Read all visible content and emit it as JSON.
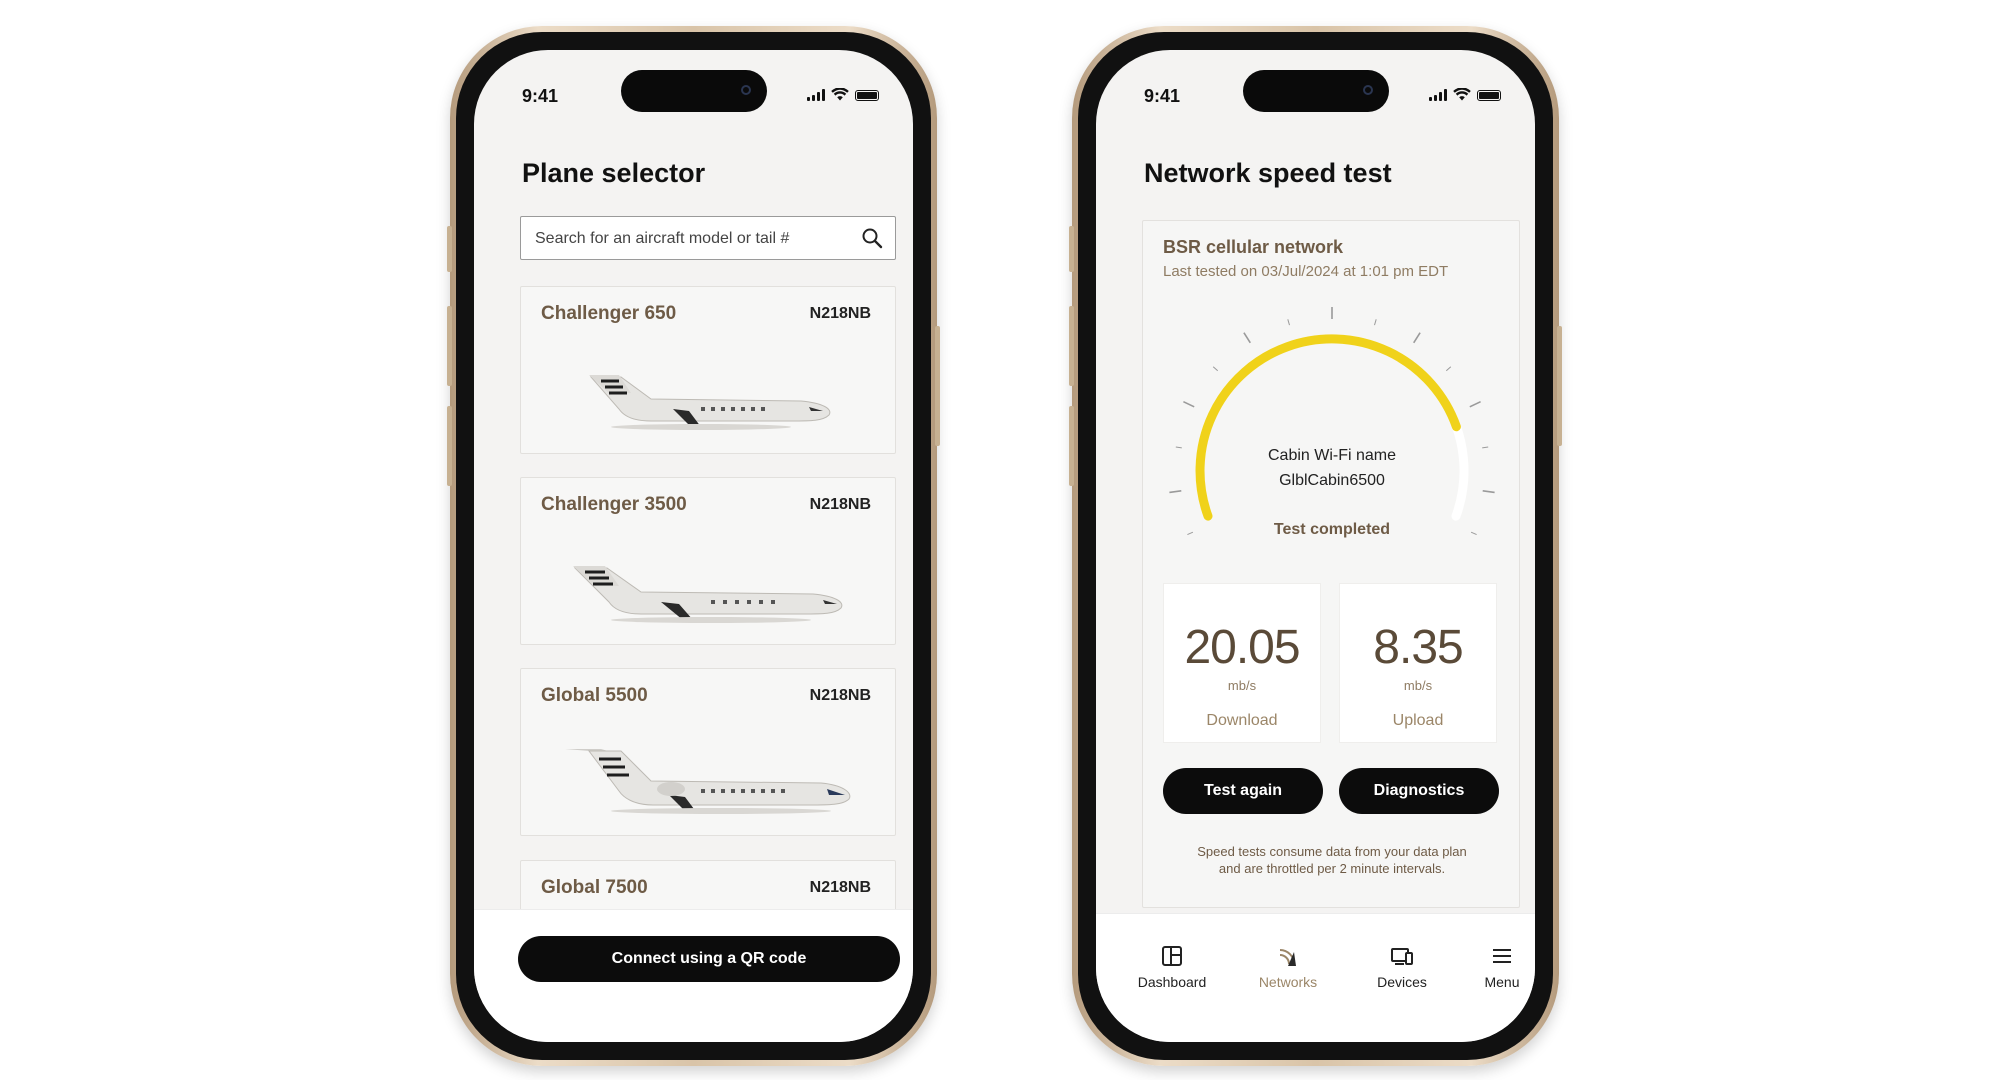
{
  "status": {
    "time": "9:41"
  },
  "plane_selector": {
    "title": "Plane selector",
    "search": {
      "placeholder": "Search for an aircraft model or tail #",
      "value": "",
      "icon": "search-icon"
    },
    "aircraft": [
      {
        "model": "Challenger 650",
        "tail": "N218NB"
      },
      {
        "model": "Challenger 3500",
        "tail": "N218NB"
      },
      {
        "model": "Global 5500",
        "tail": "N218NB"
      },
      {
        "model": "Global 7500",
        "tail": "N218NB"
      }
    ],
    "qr_button": "Connect using a QR code"
  },
  "speed_test": {
    "title": "Network speed test",
    "network_name": "BSR cellular network",
    "last_tested": "Last tested on 03/Jul/2024 at 1:01 pm EDT",
    "gauge": {
      "wifi_label": "Cabin Wi-Fi name",
      "wifi_name": "GlblCabin6500",
      "status": "Test completed",
      "progress": 0.82,
      "color": "#f0d21a"
    },
    "download": {
      "value": "20.05",
      "unit": "mb/s",
      "label": "Download"
    },
    "upload": {
      "value": "8.35",
      "unit": "mb/s",
      "label": "Upload"
    },
    "test_again": "Test again",
    "diagnostics": "Diagnostics",
    "disclaimer_line1": "Speed tests consume data from your data plan",
    "disclaimer_line2": "and are throttled per 2 minute intervals."
  },
  "tabbar": [
    {
      "label": "Dashboard",
      "icon": "dashboard-icon"
    },
    {
      "label": "Networks",
      "icon": "networks-icon",
      "active": true
    },
    {
      "label": "Devices",
      "icon": "devices-icon"
    },
    {
      "label": "Menu",
      "icon": "menu-icon"
    }
  ],
  "colors": {
    "accent_brown": "#6e5b46",
    "gauge_yellow": "#f0d21a",
    "button_black": "#0c0c0c"
  }
}
